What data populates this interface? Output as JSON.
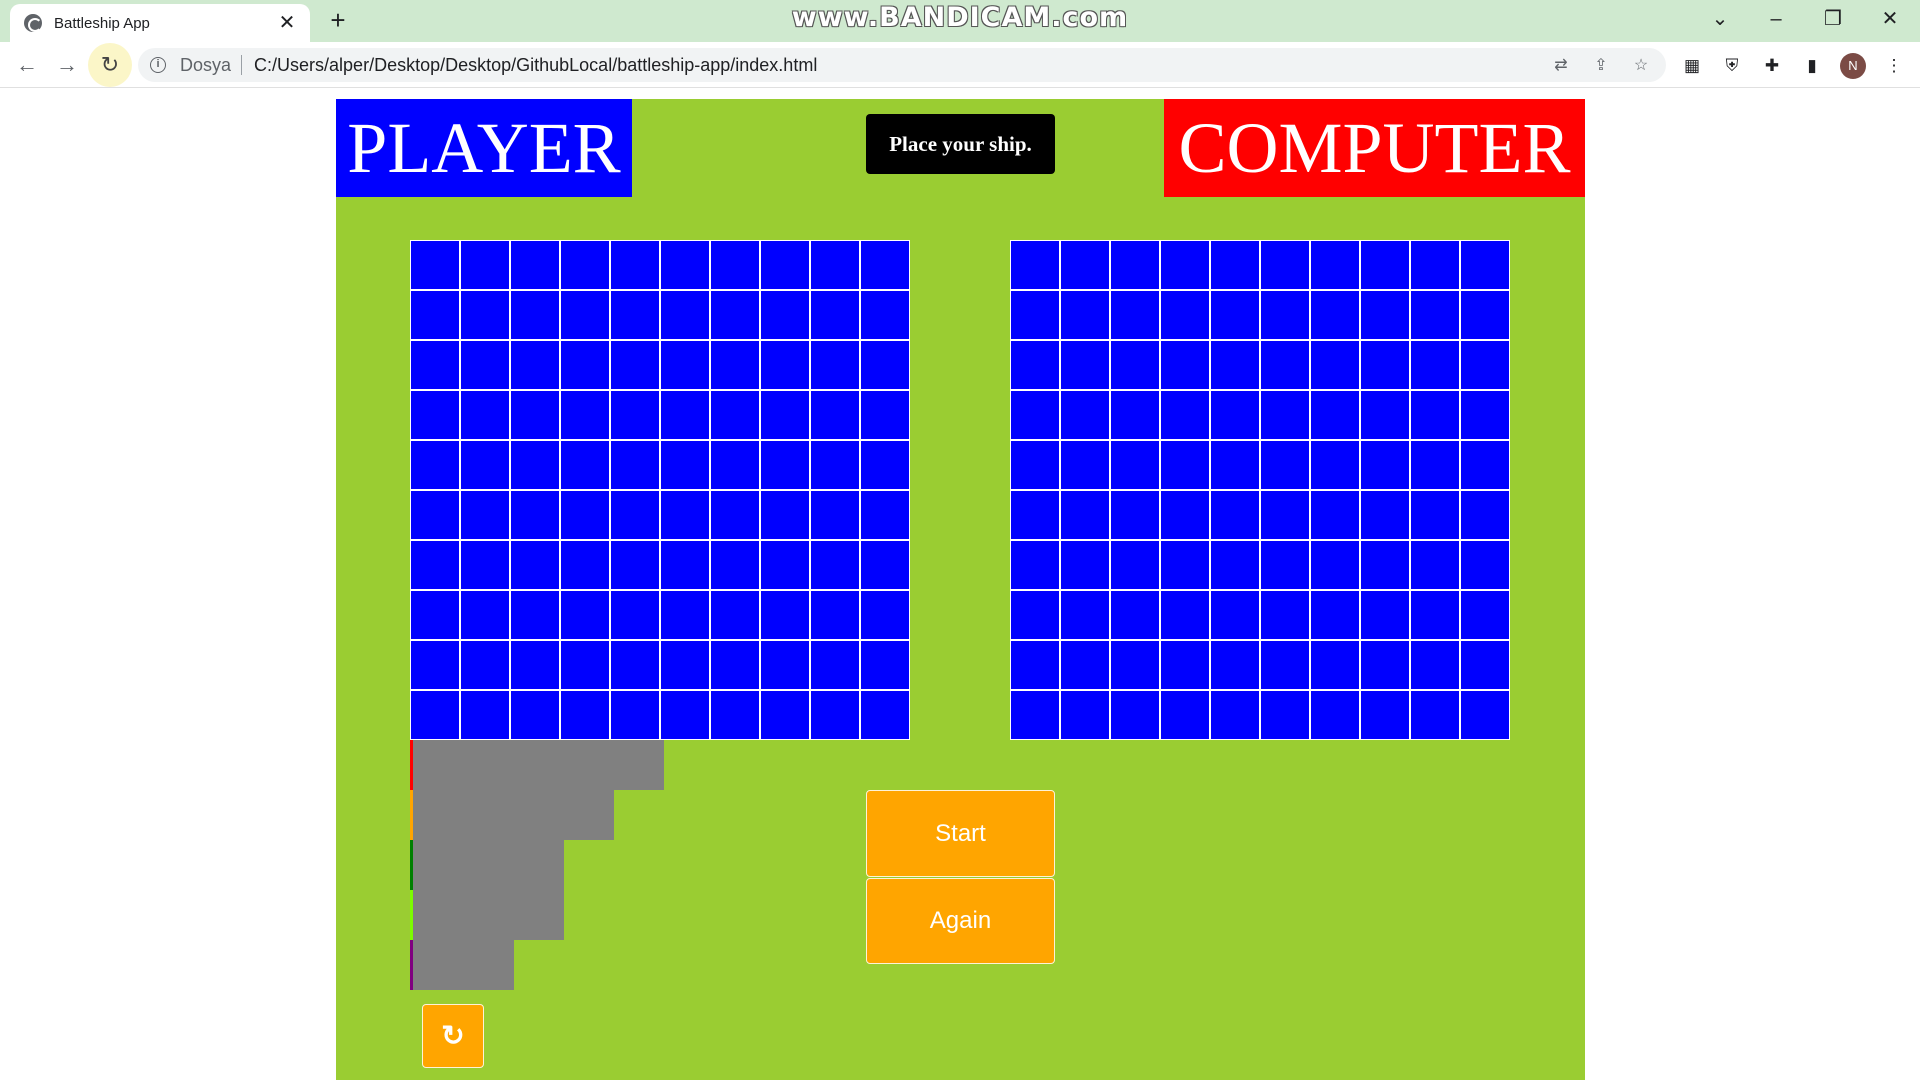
{
  "browser": {
    "tab_title": "Battleship App",
    "tab_close": "✕",
    "new_tab": "+",
    "watermark": "www.BANDICAM.com",
    "origin_label": "Dosya",
    "url": "C:/Users/alper/Desktop/Desktop/GithubLocal/battleship-app/index.html",
    "avatar_initial": "N",
    "icons": [
      "back-icon",
      "forward-icon",
      "reload-icon",
      "info-icon",
      "translate-icon",
      "share-icon",
      "star-icon",
      "extension-icon",
      "shield-icon",
      "puzzle-icon",
      "side-panel-icon",
      "menu-icon"
    ]
  },
  "game": {
    "player_title": "PLAYER",
    "computer_title": "COMPUTER",
    "info_text": "Place your ship.",
    "start_label": "Start",
    "again_label": "Again",
    "flip_icon": "↻",
    "grid_size": 10,
    "colors": {
      "background": "#9acd32",
      "board": "#0000ff",
      "player_header": "#0000ff",
      "computer_header": "#ff0000",
      "button": "#ffa500",
      "ship": "#808080"
    },
    "ships": [
      {
        "name": "carrier",
        "length": 5,
        "accent": "#ff0000"
      },
      {
        "name": "battleship",
        "length": 4,
        "accent": "#ffa500"
      },
      {
        "name": "cruiser",
        "length": 3,
        "accent": "#008000"
      },
      {
        "name": "submarine",
        "length": 3,
        "accent": "#7cfc00"
      },
      {
        "name": "destroyer",
        "length": 2,
        "accent": "#800080"
      }
    ]
  }
}
